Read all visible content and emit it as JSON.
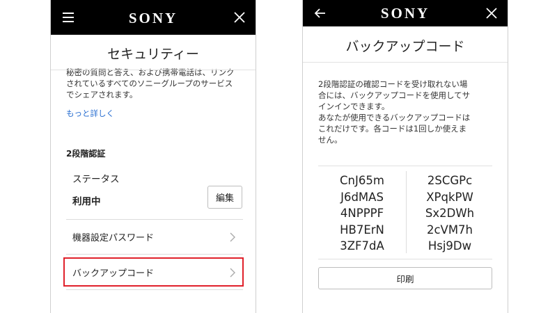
{
  "left": {
    "brand": "SONY",
    "icons": {
      "menu": "menu-icon",
      "close": "close-icon",
      "chevron": "chevron-right-icon"
    },
    "title": "セキュリティー",
    "clipped_text_lines": [
      "秘密の質問と答え、および携帯電話は、リンク",
      "されているすべてのソニーグループのサービス",
      "でシェアされます。"
    ],
    "more_link": "もっと詳しく",
    "two_step": {
      "heading": "2段階認証",
      "status_label": "ステータス",
      "status_value": "利用中",
      "edit_button": "編集"
    },
    "rows": [
      {
        "label": "機器設定パスワード"
      },
      {
        "label": "バックアップコード",
        "highlighted": true
      }
    ],
    "highlight_color": "#e0202a"
  },
  "right": {
    "brand": "SONY",
    "icons": {
      "back": "back-arrow-icon",
      "close": "close-icon"
    },
    "title": "バックアップコード",
    "description_lines": [
      "2段階認証の確認コードを受け取れない場",
      "合には、バックアップコードを使用してサ",
      "インインできます。",
      "あなたが使用できるバックアップコードは",
      "これだけです。各コードは1回しか使えま",
      "せん。"
    ],
    "codes_left": [
      "CnJ65m",
      "J6dMAS",
      "4NPPPF",
      "HB7ErN",
      "3ZF7dA"
    ],
    "codes_right": [
      "2SCGPc",
      "XPqkPW",
      "Sx2DWh",
      "2cVM7h",
      "Hsj9Dw"
    ],
    "print_button": "印刷"
  }
}
